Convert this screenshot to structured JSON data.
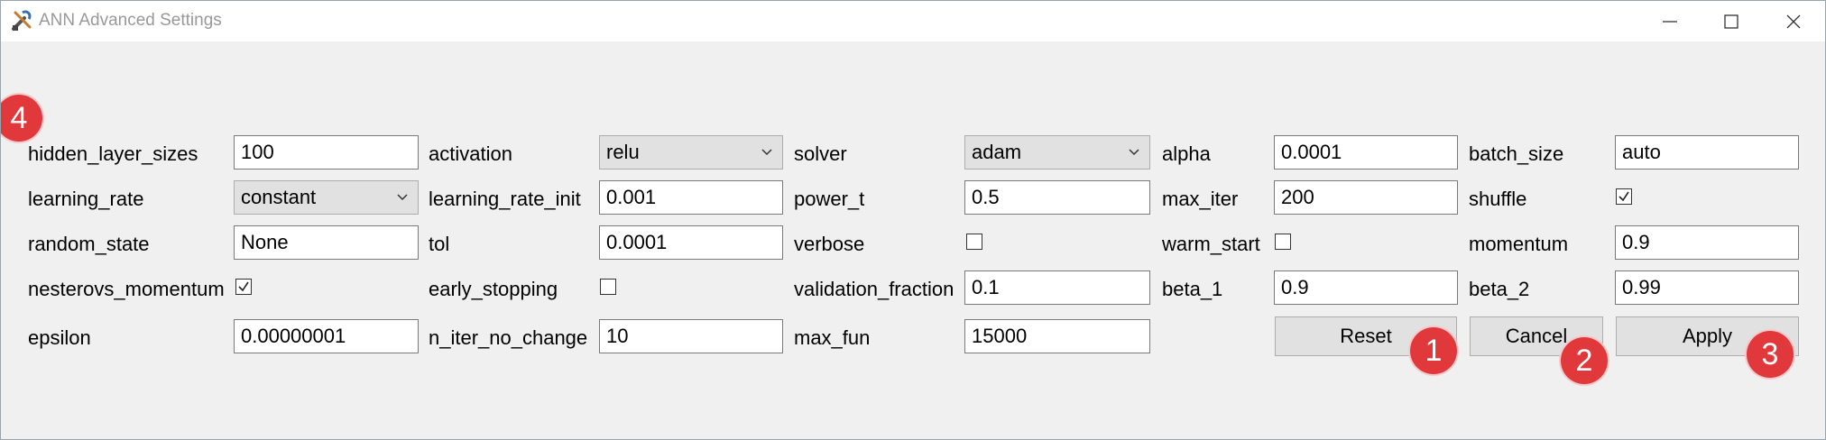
{
  "window": {
    "title": "ANN Advanced Settings",
    "app_icon": "tools-icon",
    "controls": [
      "minimize-icon",
      "maximize-icon",
      "close-icon"
    ]
  },
  "fields": {
    "hidden_layer_sizes": {
      "label": "hidden_layer_sizes",
      "value": "100"
    },
    "activation": {
      "label": "activation",
      "value": "relu"
    },
    "solver": {
      "label": "solver",
      "value": "adam"
    },
    "alpha": {
      "label": "alpha",
      "value": "0.0001"
    },
    "batch_size": {
      "label": "batch_size",
      "value": "auto"
    },
    "learning_rate": {
      "label": "learning_rate",
      "value": "constant"
    },
    "learning_rate_init": {
      "label": "learning_rate_init",
      "value": "0.001"
    },
    "power_t": {
      "label": "power_t",
      "value": "0.5"
    },
    "max_iter": {
      "label": "max_iter",
      "value": "200"
    },
    "shuffle": {
      "label": "shuffle",
      "checked": true
    },
    "random_state": {
      "label": "random_state",
      "value": "None"
    },
    "tol": {
      "label": "tol",
      "value": "0.0001"
    },
    "verbose": {
      "label": "verbose",
      "checked": false
    },
    "warm_start": {
      "label": "warm_start",
      "checked": false
    },
    "momentum": {
      "label": "momentum",
      "value": "0.9"
    },
    "nesterovs_momentum": {
      "label": "nesterovs_momentum",
      "checked": true
    },
    "early_stopping": {
      "label": "early_stopping",
      "checked": false
    },
    "validation_fraction": {
      "label": "validation_fraction",
      "value": "0.1"
    },
    "beta_1": {
      "label": "beta_1",
      "value": "0.9"
    },
    "beta_2": {
      "label": "beta_2",
      "value": "0.99"
    },
    "epsilon": {
      "label": "epsilon",
      "value": "0.00000001"
    },
    "n_iter_no_change": {
      "label": "n_iter_no_change",
      "value": "10"
    },
    "max_fun": {
      "label": "max_fun",
      "value": "15000"
    }
  },
  "buttons": {
    "reset": "Reset",
    "cancel": "Cancel",
    "apply": "Apply"
  },
  "badges": {
    "b1": "1",
    "b2": "2",
    "b3": "3",
    "b4": "4"
  },
  "colors": {
    "badge": "#e1383c",
    "background": "#f0f0f0"
  }
}
